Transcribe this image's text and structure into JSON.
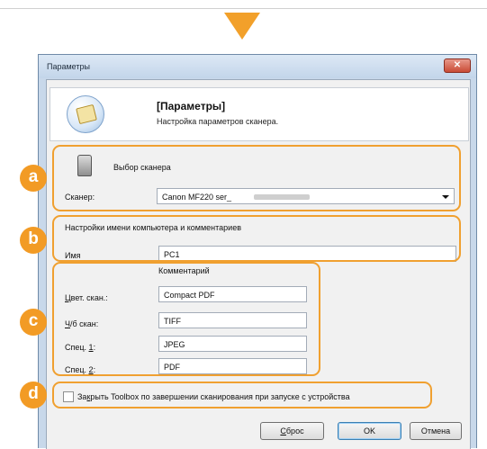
{
  "window": {
    "title": "Параметры",
    "close_glyph": "✕"
  },
  "banner": {
    "title": "[Параметры]",
    "subtitle": "Настройка параметров сканера.",
    "icon": "scanner-settings-icon"
  },
  "scanner": {
    "heading": "Выбор сканера",
    "label": "Сканер:",
    "selected": "Canon MF220 ser_",
    "icon": "scanner-icon"
  },
  "computer": {
    "heading": "Настройки имени компьютера и комментариев",
    "name_label": "Имя",
    "name_value": "PC1"
  },
  "comments": {
    "column_label": "Комментарий",
    "rows": [
      {
        "label_u": "Ц",
        "label_rest": "вет. скан.:",
        "value": "Compact PDF"
      },
      {
        "label_u": "Ч",
        "label_rest": "/б скан:",
        "value": "TIFF"
      },
      {
        "label_pre": "Спец. ",
        "label_u": "1",
        "label_rest": ":",
        "value": "JPEG"
      },
      {
        "label_pre": "Спец. ",
        "label_u": "2",
        "label_rest": ":",
        "value": "PDF"
      }
    ]
  },
  "close_toolbox": {
    "label_pre": "За",
    "label_u": "к",
    "label_rest": "рыть Toolbox по завершении сканирования при запуске с устройства",
    "checked": false
  },
  "buttons": {
    "reset_u": "С",
    "reset_rest": "брос",
    "ok": "OK",
    "cancel": "Отмена"
  },
  "callouts": [
    "a",
    "b",
    "c",
    "d"
  ],
  "colors": {
    "accent": "#f29b25",
    "window_frame": "#c8d8ea"
  }
}
